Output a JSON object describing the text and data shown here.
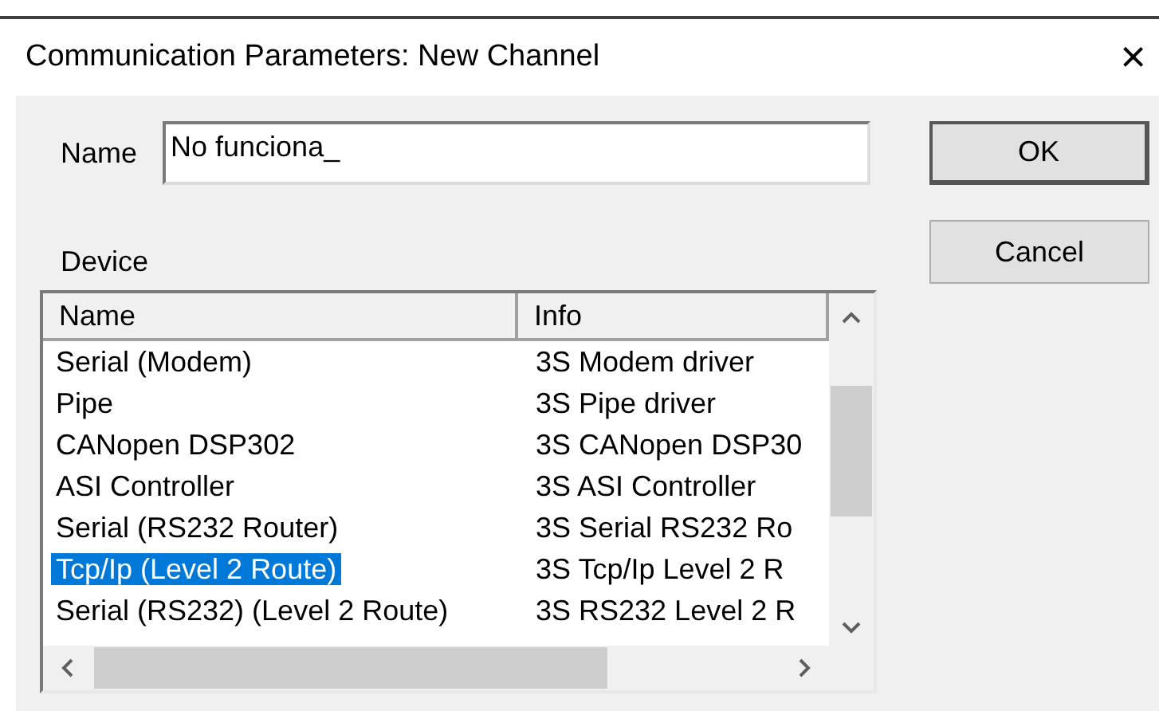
{
  "window": {
    "title": "Communication Parameters: New Channel",
    "close": "×"
  },
  "name_field": {
    "label": "Name",
    "value": "No funciona_"
  },
  "buttons": [
    "OK",
    "Cancel"
  ],
  "device": {
    "label": "Device",
    "columns": [
      "Name",
      "Info"
    ],
    "rows": [
      {
        "name": "Serial (Modem)",
        "info": "3S Modem driver",
        "selected": false
      },
      {
        "name": "Pipe",
        "info": "3S Pipe driver",
        "selected": false
      },
      {
        "name": "CANopen DSP302",
        "info": "3S CANopen DSP30",
        "selected": false
      },
      {
        "name": "ASI Controller",
        "info": "3S ASI Controller",
        "selected": false
      },
      {
        "name": "Serial (RS232 Router)",
        "info": "3S Serial RS232 Ro",
        "selected": false
      },
      {
        "name": "Tcp/Ip (Level 2 Route)",
        "info": "3S Tcp/Ip Level 2 R",
        "selected": true
      },
      {
        "name": "Serial (RS232) (Level 2 Route)",
        "info": "3S RS232 Level 2 R",
        "selected": false
      }
    ]
  }
}
